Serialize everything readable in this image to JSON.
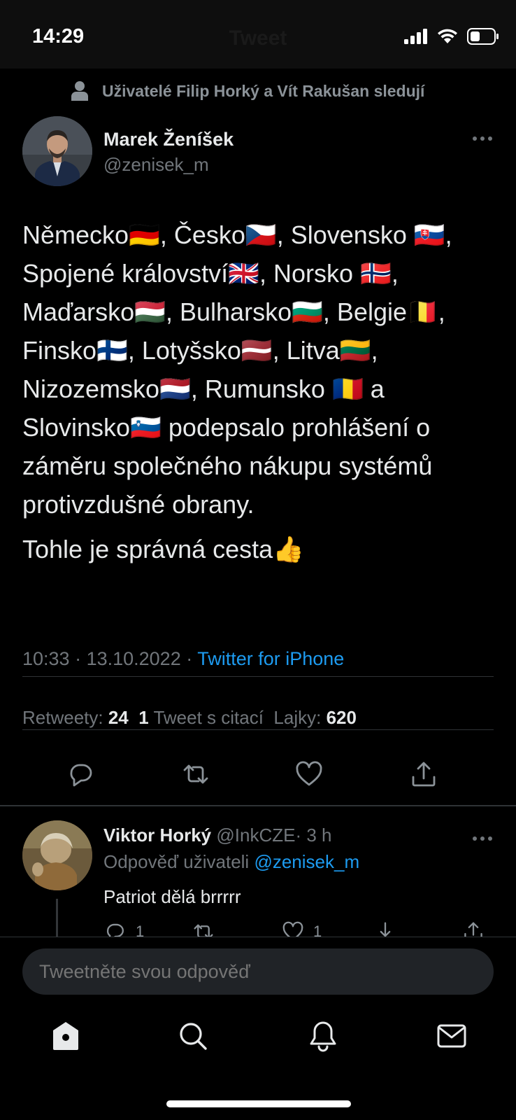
{
  "status_bar": {
    "time": "14:29",
    "title": "Tweet"
  },
  "social_context": "Uživatelé Filip Horký a Vít Rakušan sledují",
  "tweet": {
    "author_name": "Marek Ženíšek",
    "author_handle": "@zenisek_m",
    "text_p1": "Německo🇩🇪, Česko🇨🇿, Slovensko 🇸🇰, Spojené království🇬🇧, Norsko 🇳🇴, Maďarsko🇭🇺, Bulharsko🇧🇬, Belgie🇧🇪, Finsko🇫🇮, Lotyšsko🇱🇻, Litva🇱🇹, Nizozemsko🇳🇱, Rumunsko 🇷🇴 a Slovinsko🇸🇮 podepsalo prohlášení o záměru společného nákupu systémů protivzdušné obrany.",
    "text_p2": "Tohle je správná cesta👍",
    "time": "10:33",
    "date": "13.10.2022",
    "source": "Twitter for iPhone",
    "sep": " · "
  },
  "stats": {
    "retweets_label": "Retweety:",
    "retweets": "24",
    "quotes": "1",
    "quotes_label": "Tweet s citací",
    "likes_label": "Lajky:",
    "likes": "620"
  },
  "reply": {
    "name": "Viktor Horký",
    "handle": "@InkCZE",
    "time": "· 3 h",
    "replying_to_label": "Odpověď uživateli",
    "replying_to_handle": "@zenisek_m",
    "text": "Patriot dělá brrrrr",
    "reply_count": "1",
    "like_count": "1"
  },
  "compose": {
    "placeholder": "Tweetněte svou odpověď"
  },
  "icons": {
    "reply": "reply-icon",
    "retweet": "retweet-icon",
    "like": "heart-icon",
    "share": "share-icon",
    "home": "home-icon",
    "search": "search-icon",
    "notifications": "bell-icon",
    "messages": "mail-icon"
  },
  "colors": {
    "accent": "#1d9bf0",
    "background": "#000000",
    "muted": "#71767b"
  }
}
